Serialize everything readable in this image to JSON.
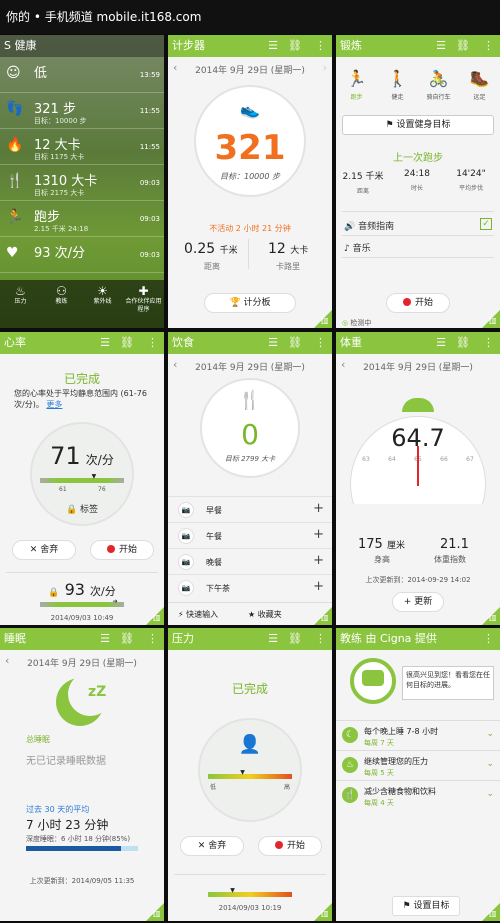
{
  "status_bar": {
    "text": "你的 • 手机频道 mobile.it168.com"
  },
  "home": {
    "title": "S 健康",
    "items": [
      {
        "value": "低",
        "sub": "",
        "time": "13:59"
      },
      {
        "value": "321 步",
        "sub": "目标：10000 步",
        "time": "11:55"
      },
      {
        "value": "12 大卡",
        "sub": "目标 1175 大卡",
        "time": "11:55"
      },
      {
        "value": "1310 大卡",
        "sub": "目标 2175 大卡",
        "time": "09:03"
      },
      {
        "value": "跑步",
        "sub": "2.15 千米  24:18",
        "time": "09:03"
      },
      {
        "value": "93 次/分",
        "sub": "",
        "time": "09:03"
      }
    ],
    "bottom": [
      "压力",
      "教练",
      "紫外线",
      "合作伙伴应用程序"
    ]
  },
  "pedometer": {
    "title": "计步器",
    "date": "2014年 9月 29日 (星期一)",
    "steps": "321",
    "goal": "目标：10000 步",
    "inactive": "不活动 2 小时 21 分钟",
    "distance": "0.25",
    "distance_unit": "千米",
    "distance_label": "距离",
    "calories": "12",
    "calories_unit": "大卡",
    "calories_label": "卡路里",
    "button": "计分板"
  },
  "exercise": {
    "title": "锻炼",
    "modes": [
      "跑步",
      "健走",
      "骑自行车",
      "远足"
    ],
    "set_goal": "设置健身目标",
    "last_run": "上一次跑步",
    "stats": [
      {
        "value": "2.15 千米",
        "label": "距离"
      },
      {
        "value": "24:18",
        "label": "时长"
      },
      {
        "value": "14'24\"",
        "label": "平均步伐"
      }
    ],
    "audio_guide": "音频指南",
    "music": "音乐",
    "start": "开始",
    "locating": "检测中"
  },
  "heart": {
    "title": "心率",
    "status": "已完成",
    "desc": "您的心率处于平均静息范围内 (61-76 次/分)。",
    "more": "更多",
    "value": "71",
    "unit": "次/分",
    "range_low": "61",
    "range_high": "76",
    "tag": "标签",
    "discard": "舍弃",
    "start": "开始",
    "last_value": "93",
    "last_unit": "次/分",
    "time": "2014/09/03 10:49",
    "marker_pos": 0.65,
    "last_marker_pos": 0.9
  },
  "food": {
    "title": "饮食",
    "date": "2014年 9月 29日 (星期一)",
    "value": "0",
    "goal": "目标 2799 大卡",
    "meals": [
      "早餐",
      "午餐",
      "晚餐",
      "下午茶"
    ],
    "quick": "快速输入",
    "fav": "收藏夹"
  },
  "weight": {
    "title": "体重",
    "date": "2014年 9月 29日 (星期一)",
    "value": "64.7",
    "ticks": [
      "63",
      "64",
      "65",
      "66",
      "67"
    ],
    "height": "175",
    "height_unit": "厘米",
    "height_label": "身高",
    "bmi": "21.1",
    "bmi_label": "体重指数",
    "updated": "上次更新到：2014-09-29 14:02",
    "update": "更新"
  },
  "sleep": {
    "title": "睡眠",
    "date": "2014年 9月 29日 (星期一)",
    "total_label": "总睡眠",
    "no_data": "无已记录睡眠数据",
    "avg_label": "过去 30 天的平均",
    "avg_value": "7 小时 23 分钟",
    "deep": "深度睡眠：6 小时 18 分钟(85%)",
    "deep_fraction": 0.85,
    "updated": "上次更新到：2014/09/05 11:35"
  },
  "stress": {
    "title": "压力",
    "status": "已完成",
    "low": "低",
    "high": "高",
    "discard": "舍弃",
    "start": "开始",
    "time": "2014/09/03 10:19",
    "marker_pos": 0.42,
    "last_marker_pos": 0.3
  },
  "coach": {
    "title": "教练 由 Cigna 提供",
    "intro": "很高兴见到您！看看您在任何目标的进展。",
    "tasks": [
      {
        "title": "每个晚上睡 7-8 小时",
        "sub": "每周 7 天"
      },
      {
        "title": "继续管理您的压力",
        "sub": "每周 5 天"
      },
      {
        "title": "减少含糖食物和饮料",
        "sub": "每周 4 天"
      }
    ],
    "set_goal": "设置目标"
  },
  "colors": {
    "accent": "#8bc53f",
    "orange": "#f07020",
    "red": "#e0262a"
  }
}
